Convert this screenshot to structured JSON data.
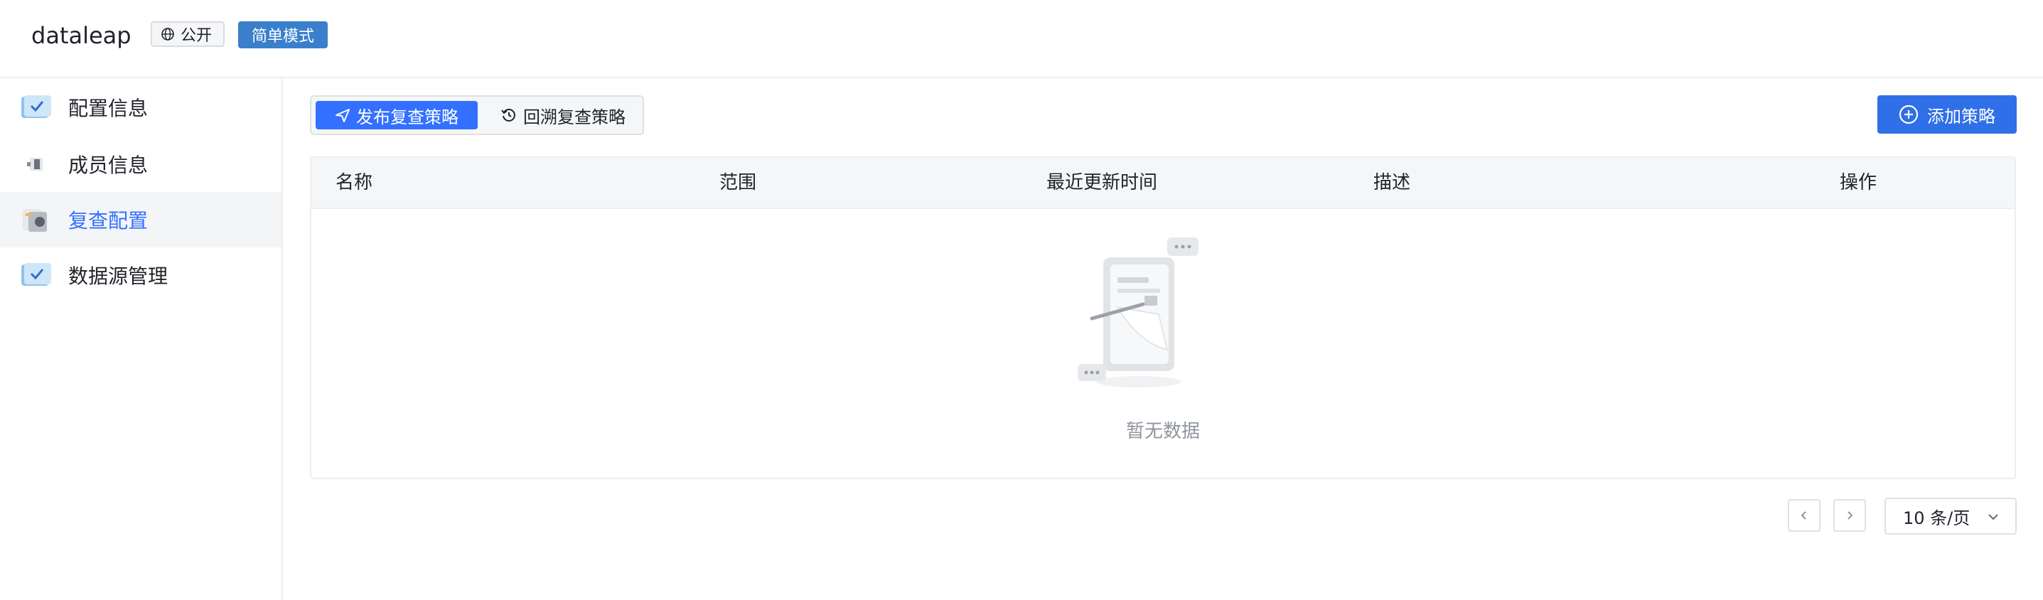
{
  "header": {
    "app_title": "dataleap",
    "public_tag": "公开",
    "mode_tag": "简单模式"
  },
  "sidebar": {
    "items": [
      {
        "label": "配置信息",
        "icon": "config-icon",
        "active": false
      },
      {
        "label": "成员信息",
        "icon": "members-icon",
        "active": false
      },
      {
        "label": "复查配置",
        "icon": "review-config-icon",
        "active": true
      },
      {
        "label": "数据源管理",
        "icon": "datasource-icon",
        "active": false
      }
    ]
  },
  "toolbar": {
    "tabs": [
      {
        "label": "发布复查策略",
        "icon": "send-icon",
        "active": true
      },
      {
        "label": "回溯复查策略",
        "icon": "history-icon",
        "active": false
      }
    ],
    "add_label": "添加策略"
  },
  "table": {
    "columns": [
      "名称",
      "范围",
      "最近更新时间",
      "描述",
      "操作"
    ],
    "rows": [],
    "empty_text": "暂无数据"
  },
  "pagination": {
    "page_size": "10 条/页"
  },
  "colors": {
    "accent": "#3370ff",
    "mode_tag": "#3a7fcb",
    "header_bg": "#f5f6f7"
  }
}
